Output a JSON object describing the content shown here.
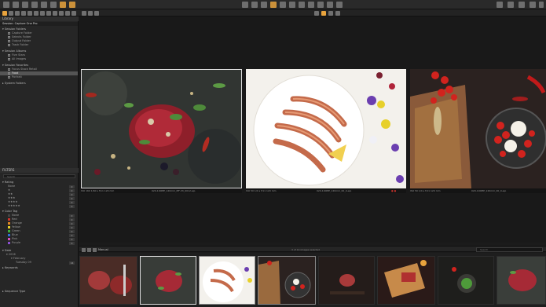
{
  "toolbar": {
    "icons": [
      "import-icon",
      "library-icon",
      "capture-icon",
      "folder-icon",
      "filter-icon",
      "adjust-icon",
      "color-icon",
      "exposure-icon",
      "lens-icon",
      "composition-icon",
      "details-icon",
      "local-adjust-icon",
      "metadata-icon",
      "output-icon",
      "batch-icon",
      "cursor-icon",
      "pan-icon",
      "zoom-icon",
      "crop-icon",
      "rotate-icon",
      "keystone-icon",
      "spot-icon",
      "picker-icon",
      "brush-icon",
      "eraser-icon",
      "gradient-icon",
      "undo-icon",
      "redo-icon",
      "grid-icon",
      "settings-icon",
      "help-icon",
      "text-icon"
    ]
  },
  "sidebar": {
    "tab_title": "Library",
    "catalog_name": "Session: Capture One Pro",
    "sections": {
      "session_folders": {
        "title": "Session Folders",
        "items": [
          "Capture Folder",
          "Selects Folder",
          "Output Folder",
          "Trash Folder"
        ]
      },
      "session_albums": {
        "title": "Session Albums",
        "items": [
          "Five Stars",
          "All Images"
        ]
      },
      "session_favorites": {
        "title": "Session Favorites",
        "items": [
          "Focus Stack Retail",
          "Food",
          "Portrait"
        ]
      },
      "system_folders": {
        "title": "System Folders"
      }
    },
    "filters": {
      "title": "FILTERS",
      "search_placeholder": "Search",
      "rating": {
        "title": "Rating",
        "items": [
          {
            "label": "None",
            "count": "0"
          },
          {
            "label": "★",
            "count": "0"
          },
          {
            "label": "★★",
            "count": "0"
          },
          {
            "label": "★★★",
            "count": "0"
          },
          {
            "label": "★★★★",
            "count": "0"
          },
          {
            "label": "★★★★★",
            "count": "0"
          }
        ]
      },
      "color_tag": {
        "title": "Color Tag",
        "items": [
          {
            "label": "None",
            "color": "#444444",
            "count": "0"
          },
          {
            "label": "Red",
            "color": "#d0342c",
            "count": "0"
          },
          {
            "label": "Orange",
            "color": "#e58a1f",
            "count": "0"
          },
          {
            "label": "Yellow",
            "color": "#e8d22a",
            "count": "0"
          },
          {
            "label": "Green",
            "color": "#3fae3a",
            "count": "0"
          },
          {
            "label": "Blue",
            "color": "#2f6fd6",
            "count": "0"
          },
          {
            "label": "Pink",
            "color": "#d64fb8",
            "count": "0"
          },
          {
            "label": "Purple",
            "color": "#8a4fd0",
            "count": "0"
          }
        ]
      },
      "date": {
        "title": "Date",
        "items": [
          "2016",
          "February",
          "Tuesday 09"
        ]
      },
      "keywords": {
        "title": "Keywords"
      },
      "sequence_type": {
        "title": "Sequence Type"
      }
    }
  },
  "viewer": {
    "images": [
      {
        "caption_left": "ISO 160 1/60 s f/11 120 mm",
        "caption_file": "020-100MP_120mm_MF-33_0012.eip"
      },
      {
        "caption_left": "ISO 50 1/4 s f/11 120 mm",
        "caption_file": "020-100MP_120mm_00_0.eip"
      },
      {
        "caption_left": "ISO 50 1/4 s f/11 120 mm",
        "caption_file": "020-100MP_120mm_00_0.eip"
      }
    ]
  },
  "browser": {
    "tab": "Manual",
    "status": "3 of 14 images selected",
    "search_placeholder": "Search"
  },
  "colors": {
    "accent": "#e8a33d",
    "selection": "#555555"
  }
}
